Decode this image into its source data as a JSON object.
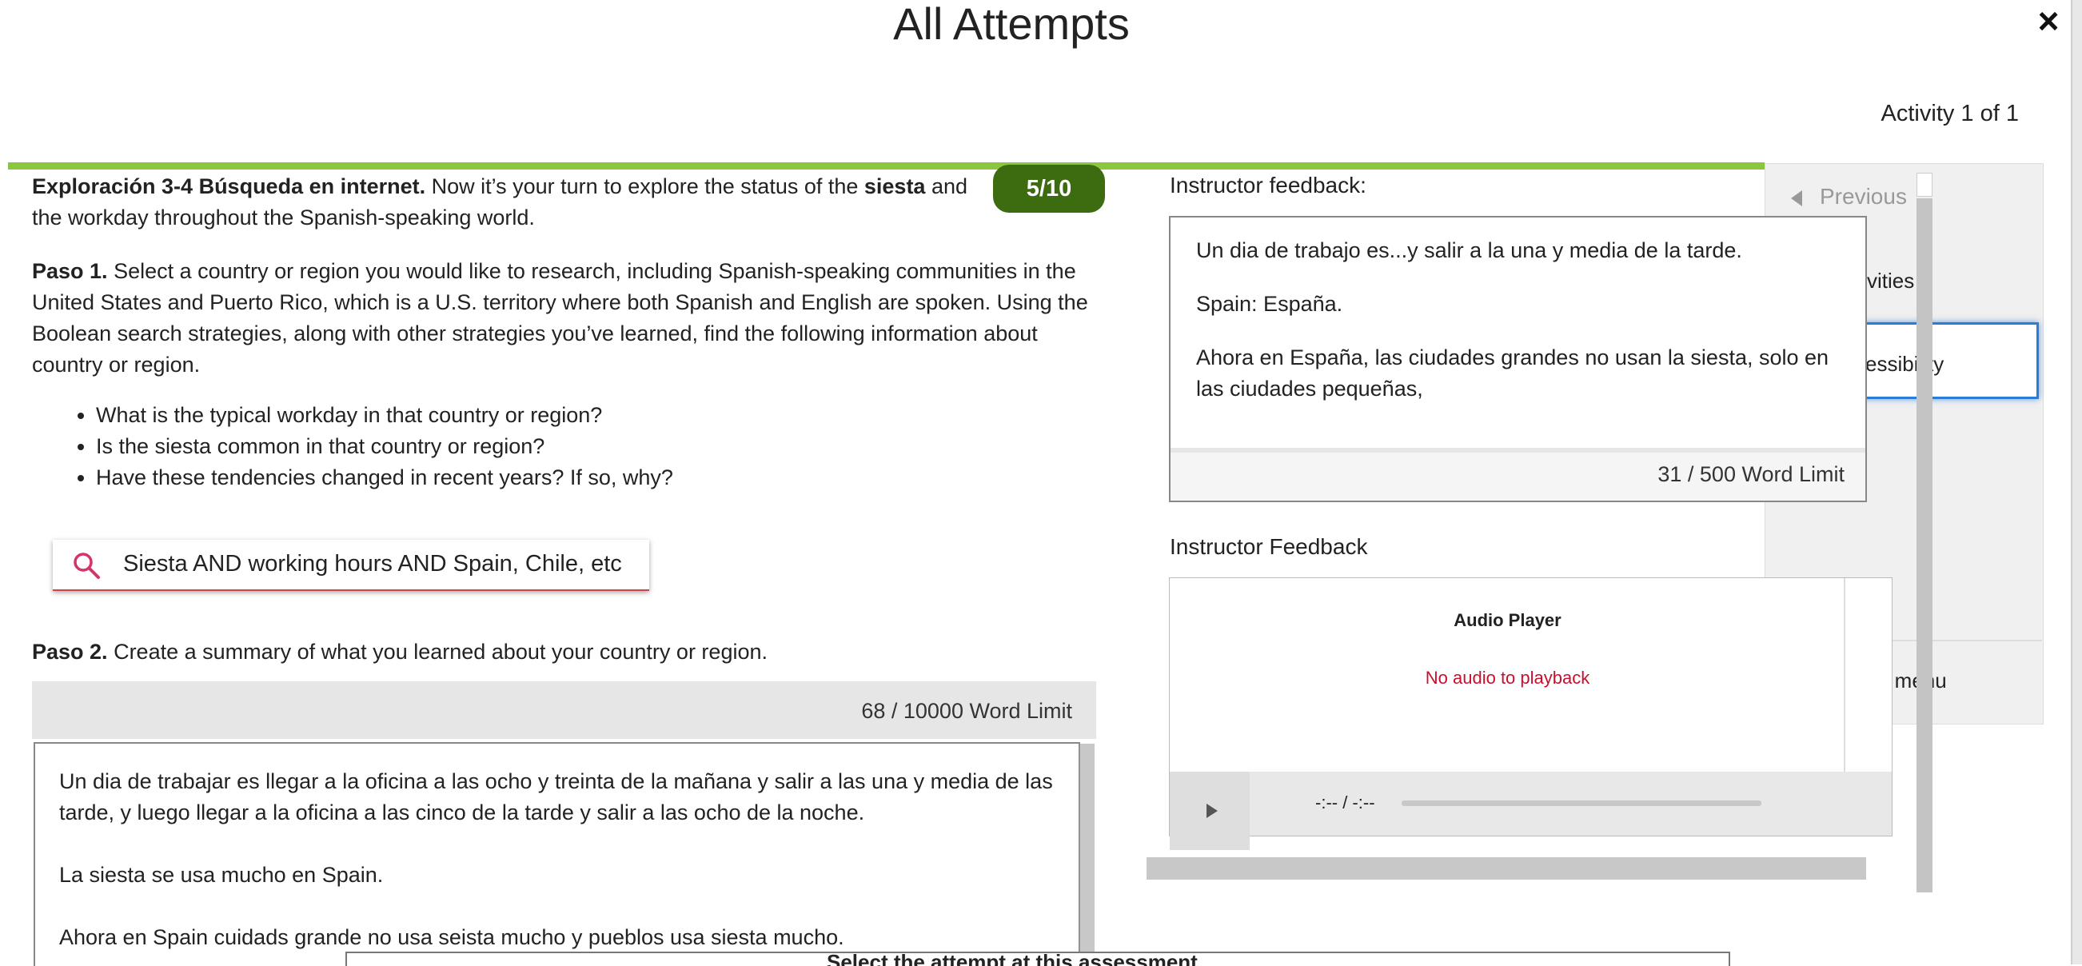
{
  "modal": {
    "title": "All Attempts",
    "close_icon": "×",
    "activity_counter": "Activity 1 of 1"
  },
  "colors": {
    "progress": "#8cc63f",
    "badge": "#3d6b0f",
    "focus_blue": "#2b7bd8",
    "error_red": "#c8102e"
  },
  "exercise": {
    "intro_bold": "Exploración 3-4 Búsqueda en internet.",
    "intro_text_a": " Now it’s your turn to explore the status of the ",
    "intro_bold2": "siesta",
    "intro_text_b": " and the workday throughout the Spanish-speaking world.",
    "score": "5/10",
    "paso1_bold": "Paso 1.",
    "paso1_text": " Select a country or region you would like to research, including Spanish-speaking communities in the United States and Puerto Rico, which is a U.S. territory where both Spanish and English are spoken. Using the Boolean search strategies, along with other strategies you’ve learned, find the following information about country or region.",
    "bullets": [
      "What is the typical workday in that country or region?",
      "Is the siesta common in that country or region?",
      "Have these tendencies changed in recent years? If so, why?"
    ],
    "search_query": "Siesta AND working hours AND Spain, Chile, etc",
    "paso2_bold": "Paso 2.",
    "paso2_text": " Create a summary of what you learned about your country or region.",
    "answer_word_count": "68 /  10000 Word Limit",
    "answer_paragraphs": [
      "Un dia de trabajar es llegar a la oficina a las ocho y treinta de la mañana y salir a las una y media de las tarde, y luego llegar a la oficina a las cinco de la tarde y salir a las ocho de la noche.",
      "La siesta se usa mucho en Spain.",
      "Ahora en Spain cuidads grande no usa seista mucho y pueblos usa siesta mucho."
    ],
    "bottom_bar_text": "Select the attempt at this assessment"
  },
  "feedback": {
    "label_text": "Instructor feedback:",
    "paragraphs": [
      "Un dia de trabajo es...y salir a la una y media de la tarde.",
      "Spain: España.",
      "Ahora en España, las ciudades grandes no usan la siesta, solo en las ciudades pequeñas,"
    ],
    "word_count": "31  /  500 Word Limit",
    "label_audio": "Instructor Feedback",
    "audio_title": "Audio Player",
    "audio_message": "No audio to playback",
    "audio_time": "-:-- / -:--"
  },
  "sidebar": {
    "previous": "Previous",
    "activities": "vities",
    "accessibility": "essibility",
    "close_menu": "se menu"
  }
}
